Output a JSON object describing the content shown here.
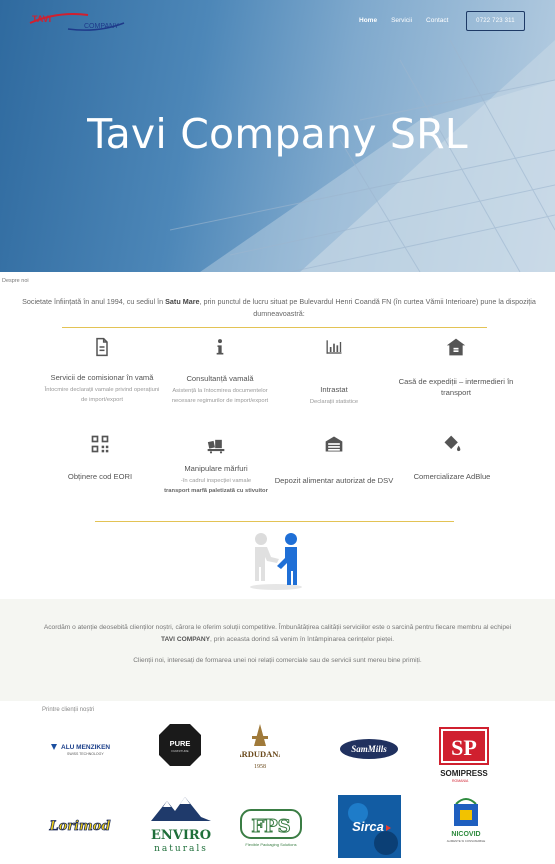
{
  "header": {
    "logo": {
      "left": "TAVI",
      "right": "COMPANY"
    },
    "nav": [
      {
        "label": "Home"
      },
      {
        "label": "Servicii"
      },
      {
        "label": "Contact"
      }
    ],
    "phone": "0722 723 311"
  },
  "hero": {
    "title": "Tavi Company SRL"
  },
  "about": {
    "label": "Despre noi",
    "intro_1": "Societate înființată în anul 1994, cu sediul în ",
    "intro_city": "Satu Mare",
    "intro_2": ", prin punctul de lucru situat pe Bulevardul Henri Coandă FN (în curtea Vămii Interioare) pune la dispoziția dumneavoastră:"
  },
  "services": [
    {
      "icon": "document-icon",
      "title": "Servicii de comisionar în vamă",
      "desc": "Întocmire declarații vamale privind operațiuni de import/export"
    },
    {
      "icon": "info-icon",
      "title": "Consultanță vamală",
      "desc": "Asistență la întocmirea documentelor necesare regimurilor de import/export"
    },
    {
      "icon": "bar-chart-icon",
      "title": "Intrastat",
      "desc": "Declarații statistice"
    },
    {
      "icon": "warehouse-icon",
      "title": "Casă de expediții – intermedieri în transport",
      "desc": ""
    },
    {
      "icon": "qr-code-icon",
      "title": "Obținere cod EORI",
      "desc": ""
    },
    {
      "icon": "pallet-icon",
      "title": "Manipulare mărfuri",
      "desc": "-în cadrul inspecției vamale",
      "desc_bold": "transport marfă paletizată cu stivuitor"
    },
    {
      "icon": "depot-icon",
      "title": "Depozit alimentar autorizat de DSV",
      "desc": ""
    },
    {
      "icon": "paint-bucket-icon",
      "title": "Comercializare AdBlue",
      "desc": ""
    }
  ],
  "band": {
    "p1_a": "Acordăm o atenție deosebită clienților noștri, cărora le oferim soluții competitive. Îmbunătățirea calității serviciilor este o sarcină pentru fiecare membru al echipei ",
    "p1_b": "TAVI COMPANY",
    "p1_c": ", prin aceasta dorind să venim în întâmpinarea cerințelor pieței.",
    "p2": "Clienții noi, interesați de formarea unei noi relații comerciale sau de servicii sunt mereu bine primiți."
  },
  "clients": {
    "label": "Printre clienții noștri",
    "logos": [
      {
        "name": "ALU MENZIKEN",
        "sub": "SWISS TECHNOLOGY"
      },
      {
        "name": "PURE",
        "sub": "FURNITURE"
      },
      {
        "name": "ARDUDANA",
        "sub": "1958"
      },
      {
        "name": "SamMills",
        "sub": ""
      },
      {
        "name": "SOMIPRESS",
        "sub": "ROMANIA",
        "mark": "SP"
      },
      {
        "name": "Lorimod",
        "sub": ""
      },
      {
        "name": "ENVIRO",
        "sub": "naturals"
      },
      {
        "name": "FPS",
        "sub": "Flexible Packaging Solutions"
      },
      {
        "name": "Sirca",
        "sub": ""
      },
      {
        "name": "NICOVID",
        "sub": "ALIMENTE SI CONSUMABILE"
      }
    ]
  },
  "colors": {
    "accent_line": "#e3c355",
    "nav_border": "#1e3a66",
    "logo_red": "#d0202f",
    "logo_blue": "#1e3a8a"
  }
}
